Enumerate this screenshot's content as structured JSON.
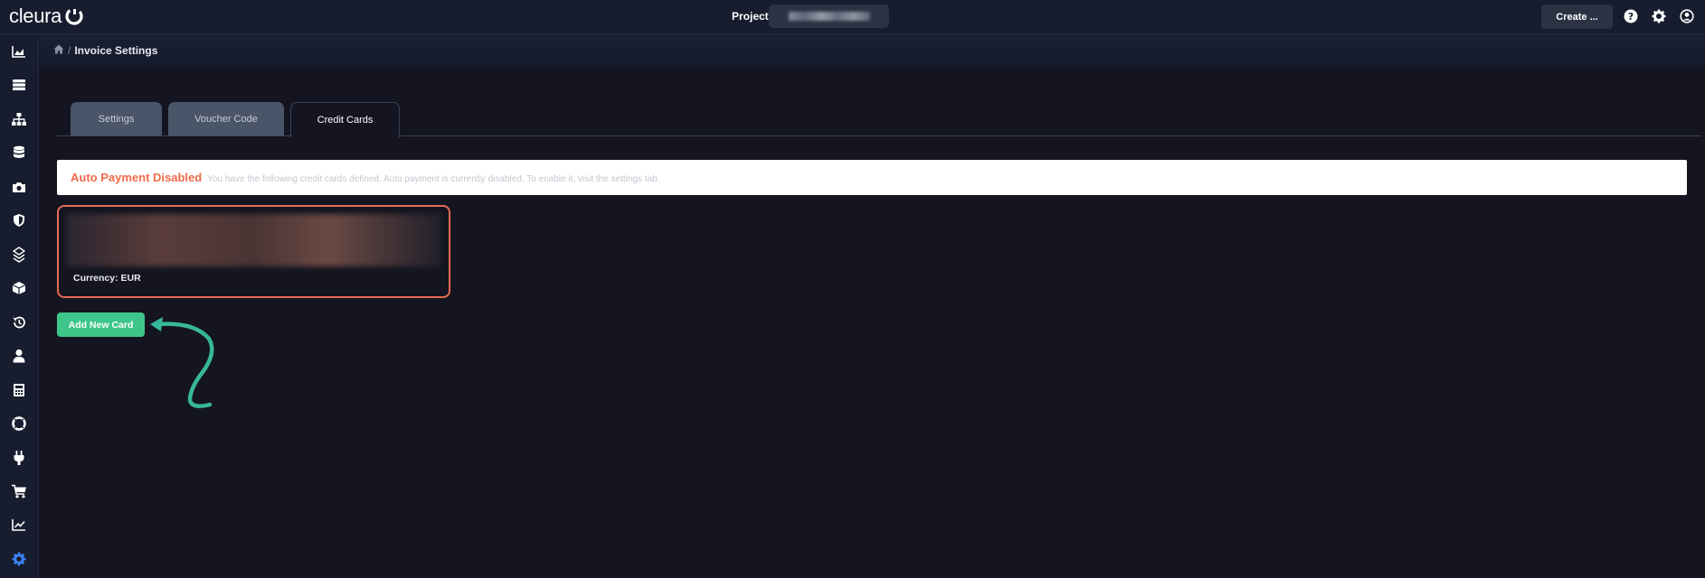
{
  "app": {
    "brand": "cleura",
    "project_label": "Project",
    "create_label": "Create ..."
  },
  "breadcrumb": {
    "home_icon": "home-icon",
    "separator": "/",
    "current": "Invoice Settings"
  },
  "tabs": [
    {
      "label": "Settings",
      "active": false
    },
    {
      "label": "Voucher Code",
      "active": false
    },
    {
      "label": "Credit Cards",
      "active": true
    }
  ],
  "notice": {
    "title": "Auto Payment Disabled",
    "text": "You have the following credit cards defined. Auto payment is currently disabled. To enable it, visit the settings tab."
  },
  "card": {
    "currency": "Currency: EUR"
  },
  "add_card_label": "Add New Card",
  "sidebar": {
    "icons": [
      "chart-area-icon",
      "servers-icon",
      "network-icon",
      "database-icon",
      "camera-icon",
      "shield-icon",
      "layers-icon",
      "cube-icon",
      "history-icon",
      "user-icon",
      "calculator-icon",
      "lifebuoy-icon",
      "plug-icon",
      "cart-icon",
      "chart-line-icon",
      "gear-icon"
    ]
  },
  "colors": {
    "accent_green": "#3ec68a",
    "warning_orange": "#ef6a4a",
    "card_border": "#e56b52",
    "active_settings_icon": "#3b82f6"
  }
}
